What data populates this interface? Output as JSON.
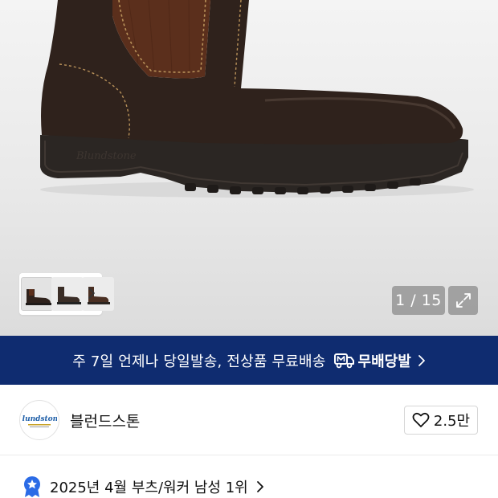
{
  "gallery": {
    "counter": "1 / 15",
    "thumbnail_count": 3,
    "icons": {
      "expand": "expand-icon",
      "next": "chevron-right-icon"
    }
  },
  "promo": {
    "text": "주 7일 언제나 당일발송, 전상품 무료배송",
    "badge_label": "무배당발",
    "colors": {
      "background": "#0f2c70",
      "text": "#ffffff"
    }
  },
  "brand": {
    "name": "블런드스톤",
    "logo_text": "Blundstone",
    "like_count": "2.5만"
  },
  "ranking": {
    "text": "2025년 4월 부츠/워커 남성 1위",
    "icon": "medal-star-icon",
    "accent": "#2b6be6"
  }
}
